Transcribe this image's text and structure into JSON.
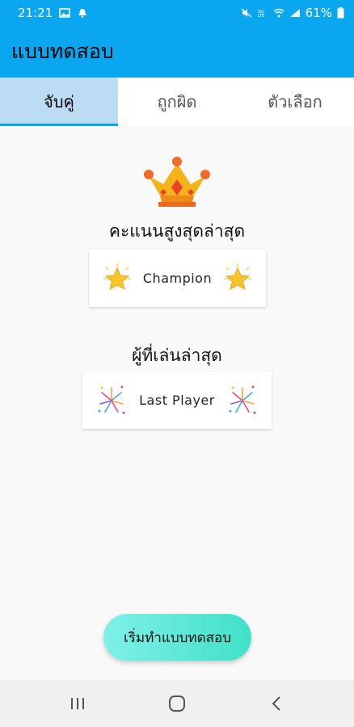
{
  "status_bar": {
    "time": "21:21",
    "battery": "61%",
    "icons": [
      "image-icon",
      "bell-icon",
      "mute-icon",
      "volte-icon",
      "wifi-icon",
      "signal-icon",
      "battery-icon"
    ]
  },
  "app_bar": {
    "title": "แบบทดสอบ",
    "color": "#0aa7f0"
  },
  "tabs": [
    {
      "label": "จับคู่",
      "active": true
    },
    {
      "label": "ถูกผิด",
      "active": false
    },
    {
      "label": "ตัวเลือก",
      "active": false
    }
  ],
  "main": {
    "crown_icon": "crown-icon",
    "high_score": {
      "title": "คะแนนสูงสุดล่าสุด",
      "value": "Champion",
      "icon": "star-icon"
    },
    "last_player": {
      "title": "ผู้ที่เล่นล่าสุด",
      "value": "Last Player",
      "icon": "fireworks-icon"
    },
    "start_button": "เริ่มทำแบบทดสอบ"
  },
  "nav_bar": {
    "icons": [
      "recent-apps-icon",
      "home-icon",
      "back-icon"
    ]
  }
}
